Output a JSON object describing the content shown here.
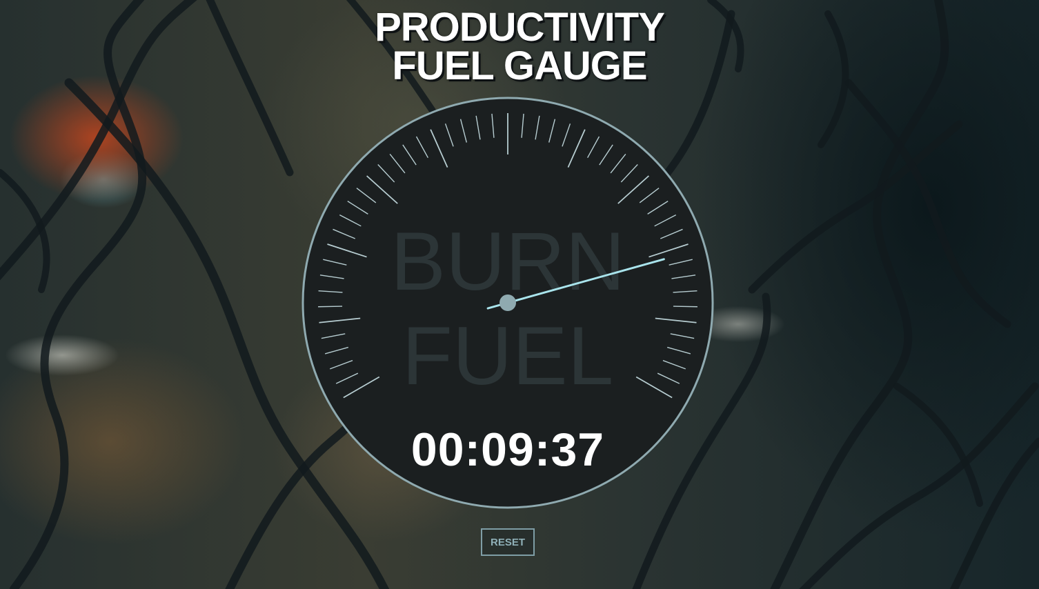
{
  "app": {
    "title_line1": "PRODUCTIVITY",
    "title_line2": "FUEL GAUGE"
  },
  "gauge": {
    "watermark_line1": "BURN",
    "watermark_line2": "FUEL",
    "elapsed": "00:09:37",
    "tick_count": 50,
    "needle_position": 0.19,
    "colors": {
      "face": "#1b1f20",
      "rim": "#8faab0",
      "ticks": "#b7cdd1",
      "needle": "#a9e4ec",
      "hub": "#8faab0",
      "watermark": "#2c3537"
    }
  },
  "controls": {
    "reset_label": "RESET"
  }
}
